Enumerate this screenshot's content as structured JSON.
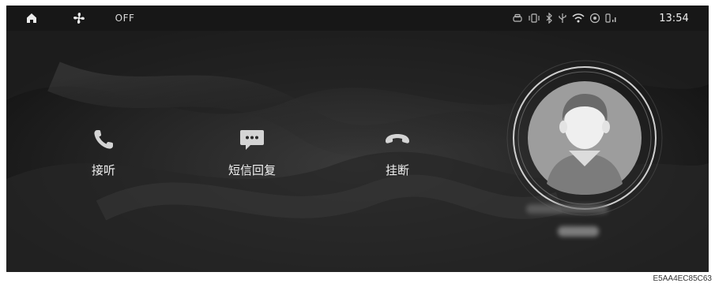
{
  "statusbar": {
    "fan_state": "OFF",
    "time": "13:54",
    "icons": [
      "home-icon",
      "fan-icon",
      "car-icon",
      "vibrate-icon",
      "bluetooth-icon",
      "usb-icon",
      "wifi-icon",
      "hotspot-icon",
      "signal-icon"
    ]
  },
  "call": {
    "actions": [
      {
        "label": "接听",
        "icon": "phone-answer-icon"
      },
      {
        "label": "短信回复",
        "icon": "message-reply-icon"
      },
      {
        "label": "挂断",
        "icon": "phone-hangup-icon"
      }
    ]
  },
  "caller": {
    "avatar_icon": "contact-avatar-icon"
  },
  "figure_code": "E5AA4EC85C63",
  "colors": {
    "screen_bg": "#1b1b1b",
    "icon_light": "#d8d8d8",
    "avatar_fill": "#9d9d9d",
    "ring": "#cfcfcf"
  }
}
